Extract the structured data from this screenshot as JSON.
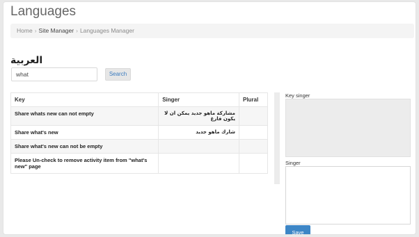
{
  "page": {
    "title": "Languages"
  },
  "breadcrumb": {
    "items": [
      "Home",
      "Site Manager",
      "Languages Manager"
    ]
  },
  "language": {
    "title": "العربية"
  },
  "search": {
    "value": "what",
    "button_label": "Search"
  },
  "table": {
    "headers": [
      "Key",
      "Singer",
      "Plural"
    ],
    "rows": [
      {
        "key": "Share whats new can not empty",
        "singer": "مشاركة ماهو جديد يمكن ان لا يكون فارغ",
        "plural": ""
      },
      {
        "key": "Share what's new",
        "singer": "شارك ماهو جديد",
        "plural": ""
      },
      {
        "key": "Share what's new can not be empty",
        "singer": "",
        "plural": ""
      },
      {
        "key": "Please Un-check to remove activity item from \"what's new\" page",
        "singer": "",
        "plural": ""
      }
    ]
  },
  "editor": {
    "key_label": "Key singer",
    "key_value": "",
    "singer_label": "Singer",
    "singer_value": "",
    "save_label": "Save"
  },
  "colors": {
    "accent": "#3d86c6",
    "link": "#3a7bbf"
  }
}
